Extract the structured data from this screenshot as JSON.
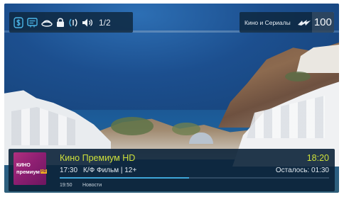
{
  "status_bar": {
    "icons": [
      "dollar-icon",
      "subtitles-icon",
      "hat-icon",
      "lock-icon",
      "radio-signal-icon",
      "volume-icon"
    ],
    "page_indicator": "1/2"
  },
  "channel_box": {
    "name": "Кино и Сериалы",
    "logo_icon": "channel-logo-icon",
    "number": "100"
  },
  "info_panel": {
    "channel_logo": {
      "line1": "КИНО",
      "line2": "премиум",
      "badge": "HD"
    },
    "channel_title": "Кино Премиум HD",
    "clock": "18:20",
    "start_time": "17:30",
    "program": "К/Ф Фильм | 12+",
    "remaining": "Осталось: 01:30",
    "progress": 0.48,
    "next_time": "19:50",
    "next_title": "Новости"
  },
  "colors": {
    "accent_yellow": "#cde03a",
    "progress_blue": "#3ea6d8",
    "panel_bg": "#0b2238",
    "logo_magenta": "#9a247a"
  }
}
